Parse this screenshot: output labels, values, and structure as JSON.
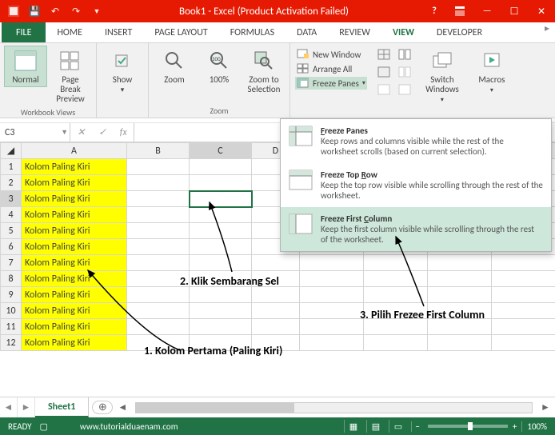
{
  "title": "Book1 - Excel (Product Activation Failed)",
  "tabs": [
    "FILE",
    "HOME",
    "INSERT",
    "PAGE LAYOUT",
    "FORMULAS",
    "DATA",
    "REVIEW",
    "VIEW",
    "DEVELOPER"
  ],
  "active_tab": "VIEW",
  "ribbon": {
    "workbook_views": {
      "label": "Workbook Views",
      "normal": "Normal",
      "pagebreak": "Page Break Preview",
      "show": "Show"
    },
    "zoom": {
      "label": "Zoom",
      "zoom": "Zoom",
      "hundred": "100%",
      "tosel": "Zoom to Selection"
    },
    "window": {
      "newwin": "New Window",
      "arrange": "Arrange All",
      "freeze": "Freeze Panes",
      "switch": "Switch Windows",
      "macros": "Macros"
    }
  },
  "freeze_menu": [
    {
      "title": "Freeze Panes",
      "key": "F",
      "desc": "Keep rows and columns visible while the rest of the worksheet scrolls (based on current selection)."
    },
    {
      "title": "Freeze Top Row",
      "key": "R",
      "desc": "Keep the top row visible while scrolling through the rest of the worksheet."
    },
    {
      "title": "Freeze First Column",
      "key": "C",
      "desc": "Keep the first column visible while scrolling through the rest of the worksheet."
    }
  ],
  "namebox": "C3",
  "columns": [
    "A",
    "B",
    "C",
    "D"
  ],
  "rows": [
    1,
    2,
    3,
    4,
    5,
    6,
    7,
    8,
    9,
    10,
    11,
    12
  ],
  "cell_text": "Kolom Paling Kiri",
  "active_cell": "C3",
  "sheet": "Sheet1",
  "status": {
    "ready": "READY",
    "rec": "",
    "url": "www.tutorialduaenam.com",
    "zoom": "100%"
  },
  "annotations": {
    "a1": "1. Kolom Pertama (Paling Kiri)",
    "a2": "2. Klik Sembarang Sel",
    "a3": "3. Pilih Frezee First Column"
  }
}
